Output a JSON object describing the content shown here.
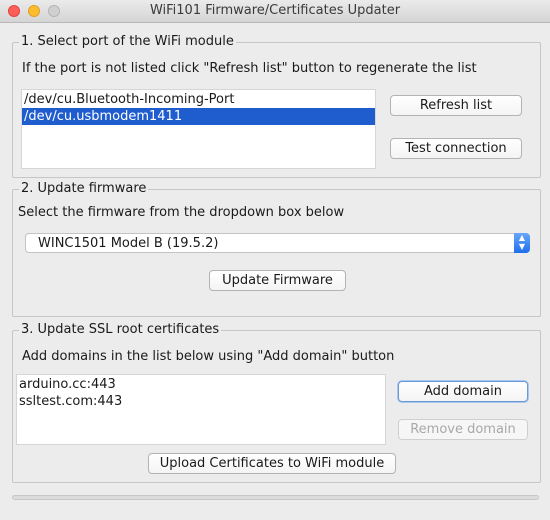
{
  "window": {
    "title": "WiFi101 Firmware/Certificates Updater"
  },
  "section1": {
    "legend": "1. Select port of the WiFi module",
    "instruction": "If the port is not listed click \"Refresh list\" button to regenerate the list",
    "ports": [
      "/dev/cu.Bluetooth-Incoming-Port",
      "/dev/cu.usbmodem1411"
    ],
    "selected_port": "/dev/cu.usbmodem1411",
    "refresh_label": "Refresh list",
    "test_label": "Test connection"
  },
  "section2": {
    "legend": "2. Update firmware",
    "instruction": "Select the firmware from the dropdown box below",
    "firmware_value": "WINC1501 Model B (19.5.2)",
    "update_label": "Update Firmware"
  },
  "section3": {
    "legend": "3. Update SSL root certificates",
    "instruction": "Add domains in the list below using \"Add domain\" button",
    "domains": [
      "arduino.cc:443",
      "ssltest.com:443"
    ],
    "add_label": "Add domain",
    "remove_label": "Remove domain",
    "upload_label": "Upload Certificates to WiFi module"
  },
  "progress": {
    "value": 0
  },
  "colors": {
    "selection": "#1f5dcf",
    "accent": "#1f6fee",
    "close": "#fc5f57",
    "minimize": "#fdbc2e"
  }
}
